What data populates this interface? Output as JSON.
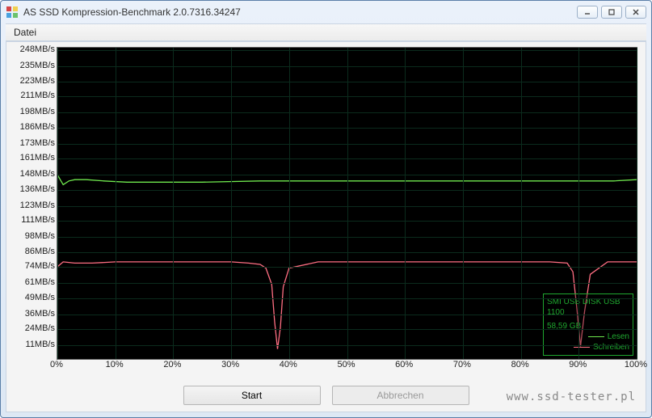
{
  "window": {
    "title": "AS SSD Kompression-Benchmark 2.0.7316.34247",
    "controls": {
      "min": "minimize",
      "max": "maximize",
      "close": "close"
    }
  },
  "menubar": {
    "file": "Datei"
  },
  "legend": {
    "device_line1": "SMI USB DISK USB",
    "device_line2": "1100",
    "capacity": "58,59 GB",
    "read": "Lesen",
    "write": "Schreiben"
  },
  "buttons": {
    "start": "Start",
    "abort": "Abbrechen"
  },
  "watermark": "www.ssd-tester.pl",
  "chart_data": {
    "type": "line",
    "xlabel": "",
    "ylabel": "",
    "xlim": [
      0,
      100
    ],
    "ylim": [
      0,
      250
    ],
    "x_ticks": [
      0,
      10,
      20,
      30,
      40,
      50,
      60,
      70,
      80,
      90,
      100
    ],
    "x_tick_labels": [
      "0%",
      "10%",
      "20%",
      "30%",
      "40%",
      "50%",
      "60%",
      "70%",
      "80%",
      "90%",
      "100%"
    ],
    "y_ticks": [
      11,
      24,
      36,
      49,
      61,
      74,
      86,
      98,
      111,
      123,
      136,
      148,
      161,
      173,
      186,
      198,
      211,
      223,
      235,
      248
    ],
    "y_tick_labels": [
      "11MB/s",
      "24MB/s",
      "36MB/s",
      "49MB/s",
      "61MB/s",
      "74MB/s",
      "86MB/s",
      "98MB/s",
      "111MB/s",
      "123MB/s",
      "136MB/s",
      "148MB/s",
      "161MB/s",
      "173MB/s",
      "186MB/s",
      "198MB/s",
      "211MB/s",
      "223MB/s",
      "235MB/s",
      "248MB/s"
    ],
    "series": [
      {
        "name": "Lesen",
        "color": "#6fe84e",
        "x": [
          0,
          1,
          2,
          3,
          5,
          8,
          12,
          18,
          25,
          35,
          45,
          55,
          65,
          75,
          85,
          92,
          96,
          100
        ],
        "y": [
          148,
          140,
          143,
          144,
          144,
          143,
          142,
          142,
          142,
          143,
          143,
          143,
          143,
          143,
          143,
          143,
          143,
          144
        ]
      },
      {
        "name": "Schreiben",
        "color": "#ff6e82",
        "x": [
          0,
          1,
          3,
          6,
          10,
          15,
          20,
          25,
          30,
          33,
          35,
          36,
          37,
          37.5,
          38,
          38.5,
          39,
          40,
          45,
          55,
          65,
          75,
          85,
          88,
          89,
          89.7,
          90.3,
          91,
          92,
          95,
          100
        ],
        "y": [
          74,
          78,
          77,
          77,
          78,
          78,
          78,
          78,
          78,
          77,
          76,
          73,
          60,
          30,
          8,
          25,
          58,
          73,
          78,
          78,
          78,
          78,
          78,
          77,
          70,
          40,
          10,
          38,
          68,
          78,
          78
        ]
      }
    ]
  }
}
